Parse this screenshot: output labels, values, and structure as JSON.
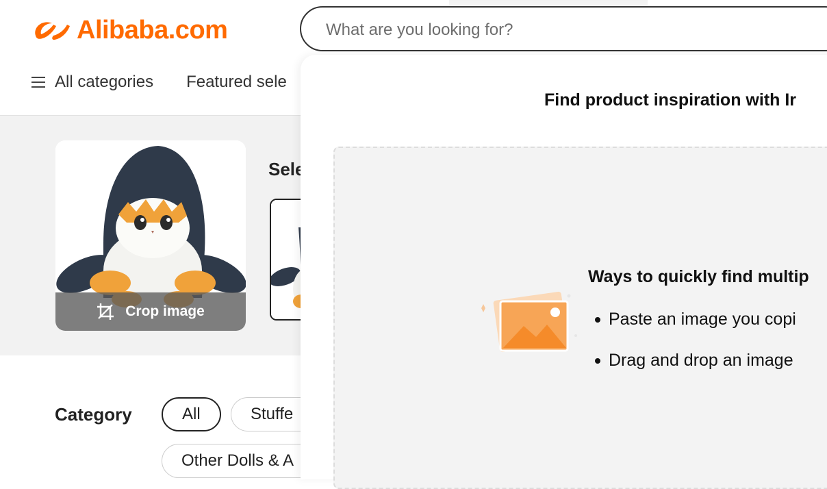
{
  "header": {
    "logo_text": "Alibaba.com",
    "brand_color": "#ff6a00",
    "search_placeholder": "What are you looking for?"
  },
  "nav": {
    "menu_icon": "hamburger-icon",
    "items": [
      {
        "label": "All categories"
      },
      {
        "label": "Featured sele"
      }
    ]
  },
  "image_search": {
    "crop_label": "Crop image",
    "crop_icon": "crop-icon",
    "select_label": "Sele"
  },
  "category": {
    "label": "Category",
    "chips": [
      {
        "label": "All",
        "selected": true
      },
      {
        "label": "Stuffe"
      },
      {
        "label": "Other Dolls & A"
      }
    ]
  },
  "panel": {
    "title": "Find product inspiration with Ir",
    "ways_heading": "Ways to quickly find multip",
    "ways": [
      "Paste an image you copi",
      "Drag and drop an image"
    ],
    "illustration_icon": "image-upload-icon"
  }
}
